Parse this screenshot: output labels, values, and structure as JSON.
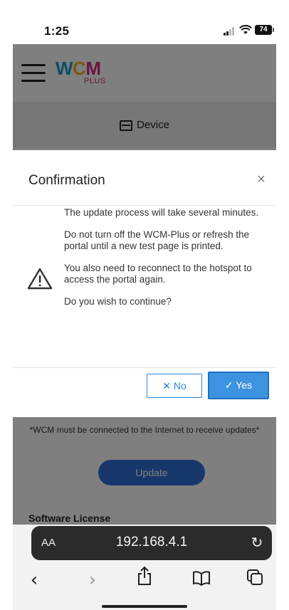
{
  "status_bar": {
    "time": "1:25",
    "battery": "74"
  },
  "header": {
    "logo_text": "WCM",
    "logo_sub": "PLUS",
    "brand_colors": {
      "w": "#1a9bd7",
      "c": "#f2b21c",
      "m": "#d6287c"
    }
  },
  "device_bar": {
    "label": "Device",
    "icon": "device-icon"
  },
  "background": {
    "notice": "*WCM must be connected to the Internet to receive updates*",
    "update_button": "Update",
    "license_label": "Software License"
  },
  "modal": {
    "title": "Confirmation",
    "close_label": "×",
    "paragraphs": [
      "The update process will take several minutes.",
      "Do not turn off the WCM-Plus or refresh the portal until a new test page is printed.",
      "You also need to reconnect to the hotspot to access the portal again.",
      "Do you wish to continue?"
    ],
    "no_label": "✕  No",
    "yes_label": "✓  Yes",
    "accent": "#3d93e0"
  },
  "browser": {
    "aa": "AA",
    "url": "192.168.4.1",
    "reload": "↻",
    "back": "‹",
    "forward": "›",
    "share": "⇧",
    "bookmarks": "📖",
    "tabs": "⧉"
  }
}
